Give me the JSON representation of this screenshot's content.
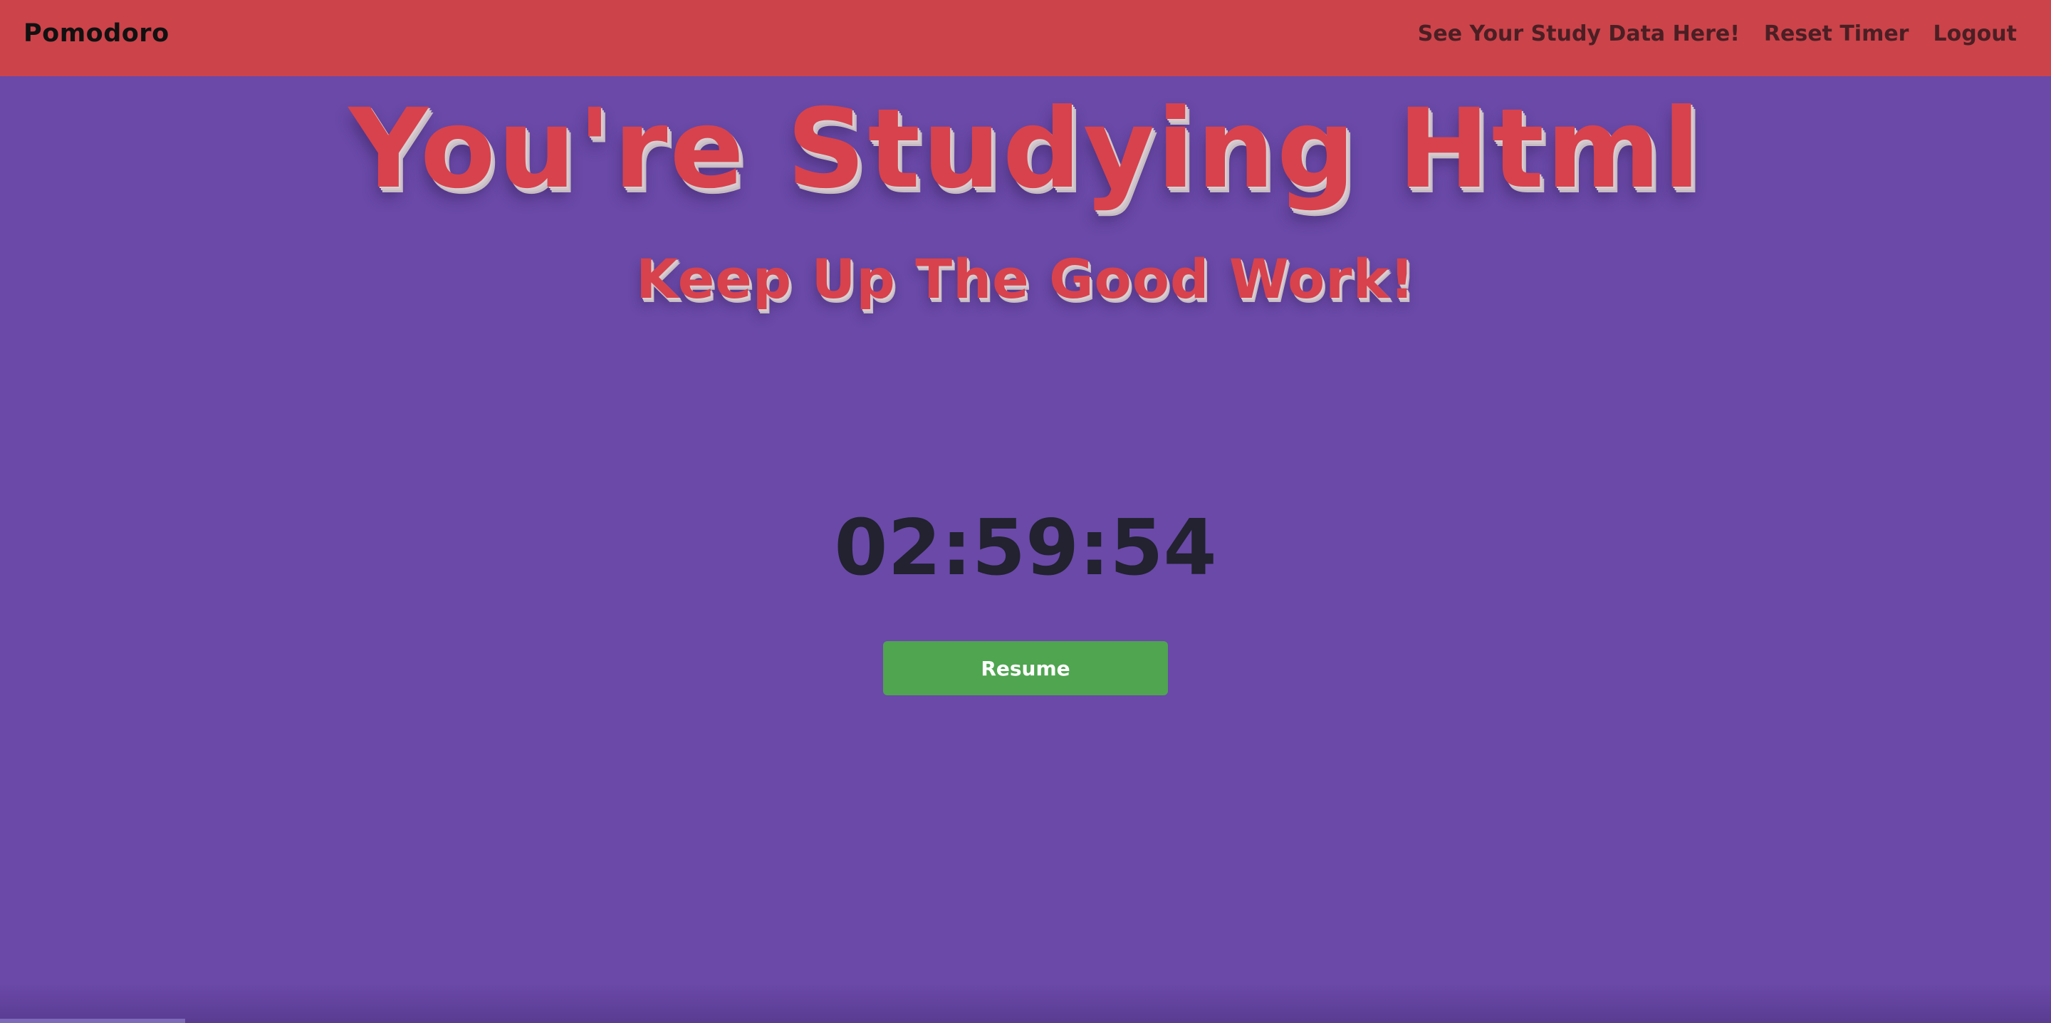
{
  "navbar": {
    "brand": "Pomodoro",
    "links": [
      {
        "label": "See Your Study Data Here!"
      },
      {
        "label": "Reset Timer"
      },
      {
        "label": "Logout"
      }
    ],
    "color": "#cc434a"
  },
  "main": {
    "title": "You're Studying Html",
    "subtitle": "Keep Up The Good Work!",
    "timer": "02:59:54",
    "resume_label": "Resume",
    "background_color": "#6a49a8",
    "accent_color": "#d8424c",
    "button_color": "#4fa550"
  }
}
